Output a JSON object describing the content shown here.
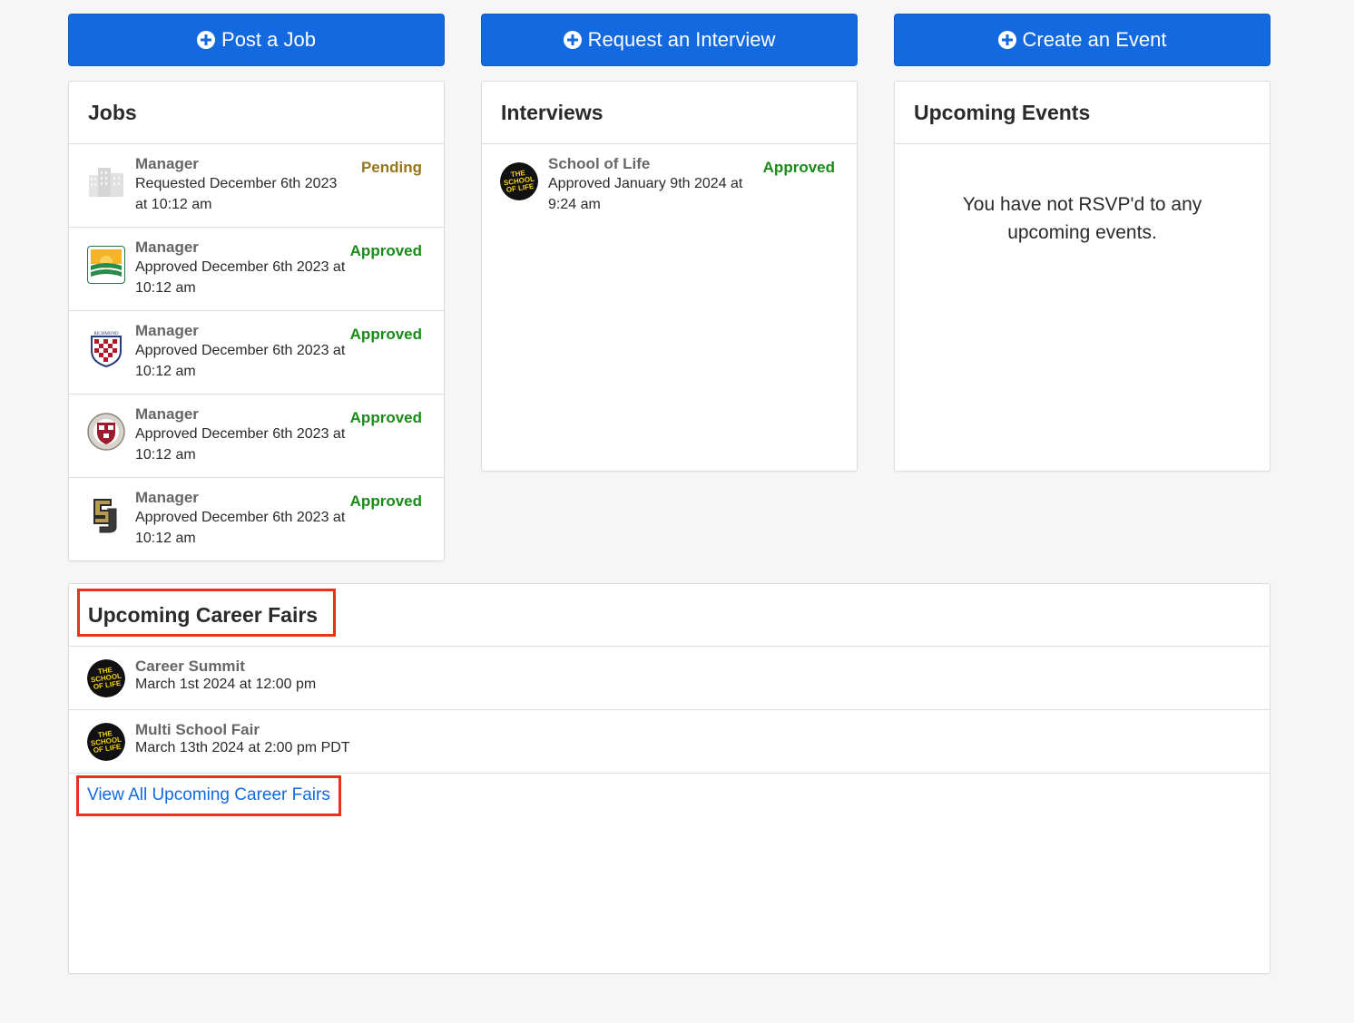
{
  "buttons": {
    "post_job": "Post a Job",
    "request_interview": "Request an Interview",
    "create_event": "Create an Event"
  },
  "jobs": {
    "title": "Jobs",
    "items": [
      {
        "title": "Manager",
        "sub": "Requested December 6th 2023 at 10:12 am",
        "status": "Pending",
        "logo": "building-icon"
      },
      {
        "title": "Manager",
        "sub": "Approved December 6th 2023 at 10:12 am",
        "status": "Approved",
        "logo": "landscape-logo"
      },
      {
        "title": "Manager",
        "sub": "Approved December 6th 2023 at 10:12 am",
        "status": "Approved",
        "logo": "richmond-shield-logo"
      },
      {
        "title": "Manager",
        "sub": "Approved December 6th 2023 at 10:12 am",
        "status": "Approved",
        "logo": "harvard-seal-logo"
      },
      {
        "title": "Manager",
        "sub": "Approved December 6th 2023 at 10:12 am",
        "status": "Approved",
        "logo": "su-monogram-logo"
      }
    ]
  },
  "interviews": {
    "title": "Interviews",
    "items": [
      {
        "title": "School of Life",
        "sub": "Approved January 9th 2024 at 9:24 am",
        "status": "Approved",
        "logo": "school-of-life-logo"
      }
    ]
  },
  "events": {
    "title": "Upcoming Events",
    "empty": "You have not RSVP'd to any upcoming events."
  },
  "career_fairs": {
    "title": "Upcoming Career Fairs",
    "items": [
      {
        "title": "Career Summit",
        "sub": "March 1st 2024 at 12:00 pm"
      },
      {
        "title": "Multi School Fair",
        "sub": "March 13th 2024 at 2:00 pm PDT"
      }
    ],
    "view_all": "View All Upcoming Career Fairs"
  },
  "logo_text": {
    "sol": [
      "THE",
      "SCHOOL",
      "OF LIFE"
    ],
    "richmond": "RICHMOND"
  },
  "colors": {
    "primary": "#1369e0",
    "approved": "#1a8a1a",
    "pending": "#97771a",
    "highlight": "#e8321e"
  }
}
